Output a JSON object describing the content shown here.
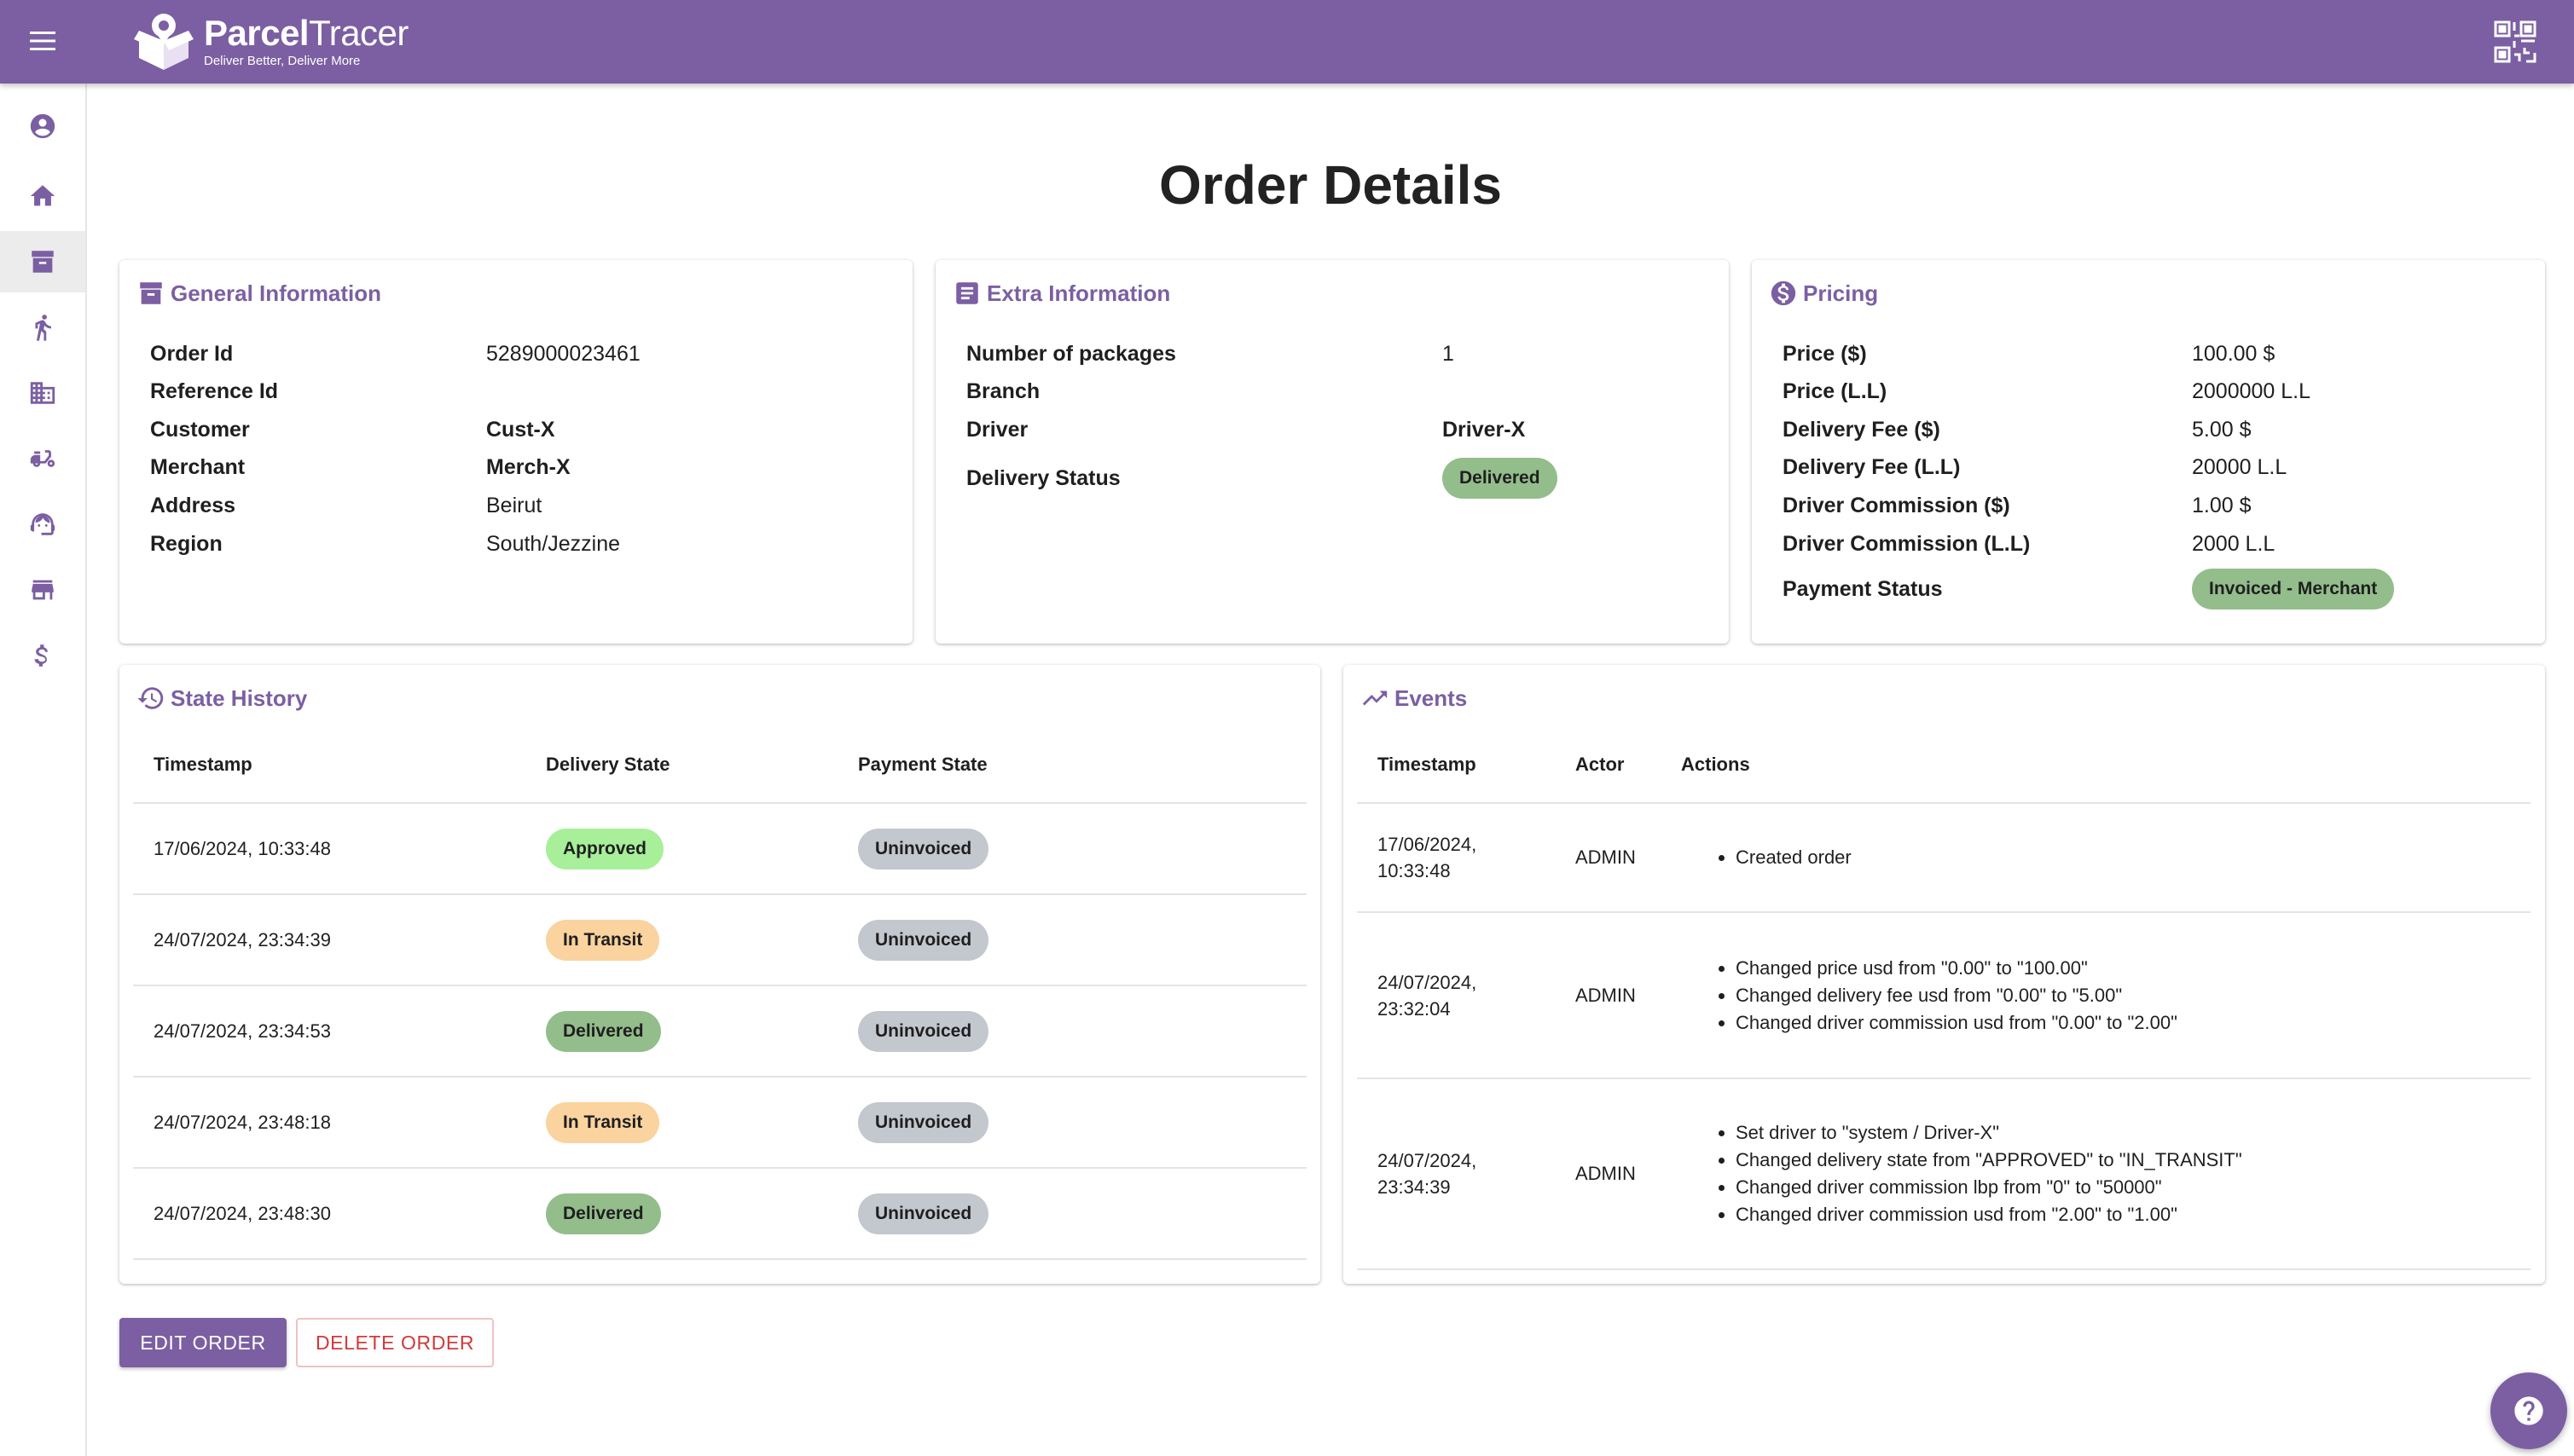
{
  "app": {
    "brand_strong": "Parcel",
    "brand_light": "Tracer",
    "tagline": "Deliver Better, Deliver More",
    "accent_color": "#7b5fa2"
  },
  "sidebar": {
    "items": [
      {
        "icon": "account-circle-icon"
      },
      {
        "icon": "home-icon"
      },
      {
        "icon": "archive-box-icon",
        "active": true
      },
      {
        "icon": "delivery-person-icon"
      },
      {
        "icon": "business-building-icon"
      },
      {
        "icon": "scooter-icon"
      },
      {
        "icon": "support-agent-icon"
      },
      {
        "icon": "store-icon"
      },
      {
        "icon": "dollar-icon"
      }
    ]
  },
  "page": {
    "title": "Order Details"
  },
  "general": {
    "title": "General Information",
    "rows": [
      {
        "label": "Order Id",
        "value": "5289000023461"
      },
      {
        "label": "Reference Id",
        "value": ""
      },
      {
        "label": "Customer",
        "value": "Cust-X"
      },
      {
        "label": "Merchant",
        "value": "Merch-X"
      },
      {
        "label": "Address",
        "value": "Beirut"
      },
      {
        "label": "Region",
        "value": "South/Jezzine"
      }
    ]
  },
  "extra": {
    "title": "Extra Information",
    "rows": [
      {
        "label": "Number of packages",
        "value": "1"
      },
      {
        "label": "Branch",
        "value": ""
      },
      {
        "label": "Driver",
        "value": "Driver-X"
      },
      {
        "label": "Delivery Status",
        "value": "Delivered"
      }
    ]
  },
  "pricing": {
    "title": "Pricing",
    "rows": [
      {
        "label": "Price ($)",
        "value": "100.00 $"
      },
      {
        "label": "Price (L.L)",
        "value": "2000000 L.L"
      },
      {
        "label": "Delivery Fee ($)",
        "value": "5.00 $"
      },
      {
        "label": "Delivery Fee (L.L)",
        "value": "20000 L.L"
      },
      {
        "label": "Driver Commission ($)",
        "value": "1.00 $"
      },
      {
        "label": "Driver Commission (L.L)",
        "value": "2000 L.L"
      },
      {
        "label": "Payment Status",
        "value": "Invoiced - Merchant"
      }
    ]
  },
  "state_history": {
    "title": "State History",
    "columns": [
      "Timestamp",
      "Delivery State",
      "Payment State"
    ],
    "rows": [
      {
        "timestamp": "17/06/2024, 10:33:48",
        "delivery": "Approved",
        "payment": "Uninvoiced"
      },
      {
        "timestamp": "24/07/2024, 23:34:39",
        "delivery": "In Transit",
        "payment": "Uninvoiced"
      },
      {
        "timestamp": "24/07/2024, 23:34:53",
        "delivery": "Delivered",
        "payment": "Uninvoiced"
      },
      {
        "timestamp": "24/07/2024, 23:48:18",
        "delivery": "In Transit",
        "payment": "Uninvoiced"
      },
      {
        "timestamp": "24/07/2024, 23:48:30",
        "delivery": "Delivered",
        "payment": "Uninvoiced"
      }
    ]
  },
  "events": {
    "title": "Events",
    "columns": [
      "Timestamp",
      "Actor",
      "Actions"
    ],
    "rows": [
      {
        "timestamp_date": "17/06/2024,",
        "timestamp_time": "10:33:48",
        "actor": "ADMIN",
        "actions": [
          "Created order"
        ]
      },
      {
        "timestamp_date": "24/07/2024,",
        "timestamp_time": "23:32:04",
        "actor": "ADMIN",
        "actions": [
          "Changed price usd from \"0.00\" to \"100.00\"",
          "Changed delivery fee usd from \"0.00\" to \"5.00\"",
          "Changed driver commission usd from \"0.00\" to \"2.00\""
        ]
      },
      {
        "timestamp_date": "24/07/2024,",
        "timestamp_time": "23:34:39",
        "actor": "ADMIN",
        "actions": [
          "Set driver to \"system / Driver-X\"",
          "Changed delivery state from \"APPROVED\" to \"IN_TRANSIT\"",
          "Changed driver commission lbp from \"0\" to \"50000\"",
          "Changed driver commission usd from \"2.00\" to \"1.00\""
        ]
      }
    ]
  },
  "buttons": {
    "edit": "EDIT ORDER",
    "delete": "DELETE ORDER"
  }
}
